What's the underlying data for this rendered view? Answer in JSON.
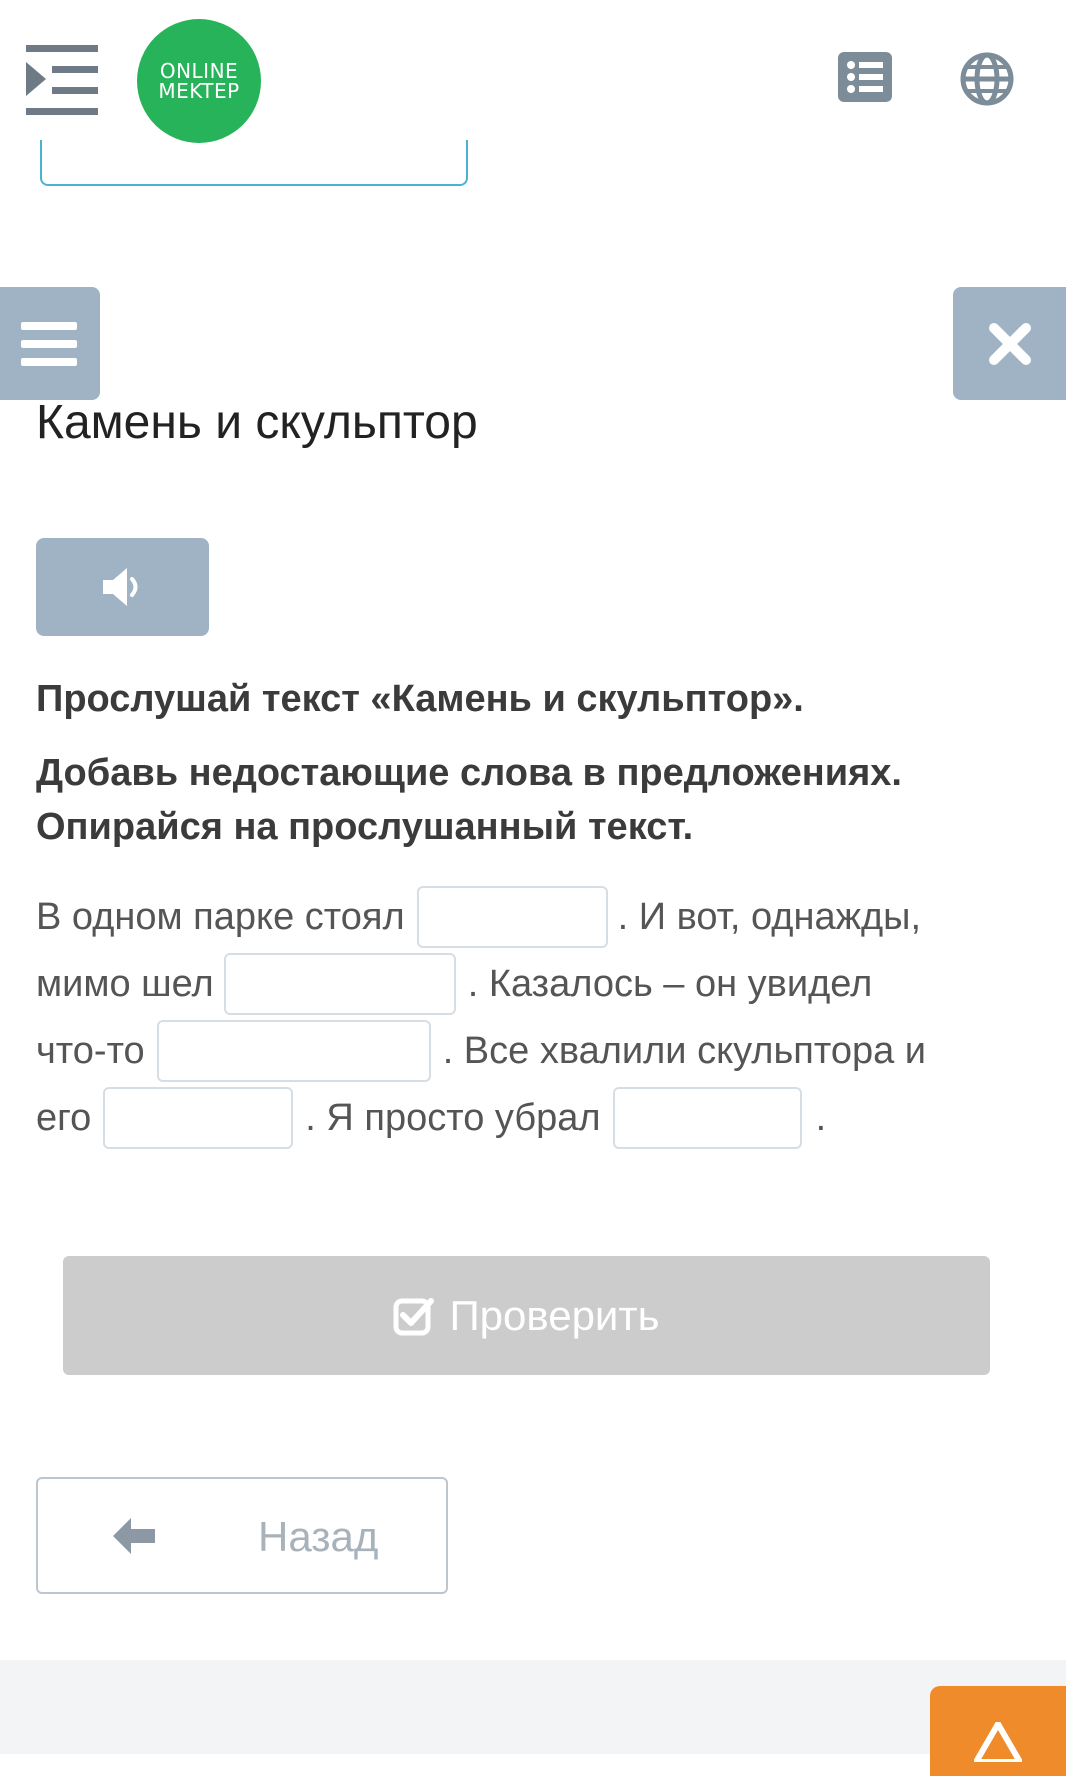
{
  "header": {
    "logo_line1": "ONLINE",
    "logo_line2": "MEKTEP",
    "icons": [
      "menu-indent-icon",
      "list-icon",
      "globe-icon"
    ]
  },
  "side": {
    "left_icon": "hamburger-icon",
    "right_icon": "close-icon"
  },
  "lesson": {
    "title": "Камень и скульптор",
    "audio_icon": "speaker-icon",
    "instruction1": "Прослушай текст «Камень и скульптор».",
    "instruction2a": "Добавь недостающие слова в предложениях.",
    "instruction2b": "Опирайся на прослушанный текст."
  },
  "exercise": {
    "line1_a": "В одном парке стоял",
    "line1_b": ".  И вот, однажды,",
    "line2_a": "мимо шел",
    "line2_b": ".  Казалось – он увидел",
    "line3_a": "что-то",
    "line3_b": ".  Все хвалили скульптора и",
    "line4_a": "его",
    "line4_b": ".  Я просто убрал",
    "line4_c": ".",
    "blanks": [
      "",
      "",
      "",
      "",
      ""
    ]
  },
  "actions": {
    "check_label": "Проверить",
    "back_label": "Назад"
  },
  "colors": {
    "logo_green": "#27b35a",
    "slate_button": "#9fb3c4",
    "disabled_button": "#cccccc",
    "help_orange": "#f08b2c"
  }
}
